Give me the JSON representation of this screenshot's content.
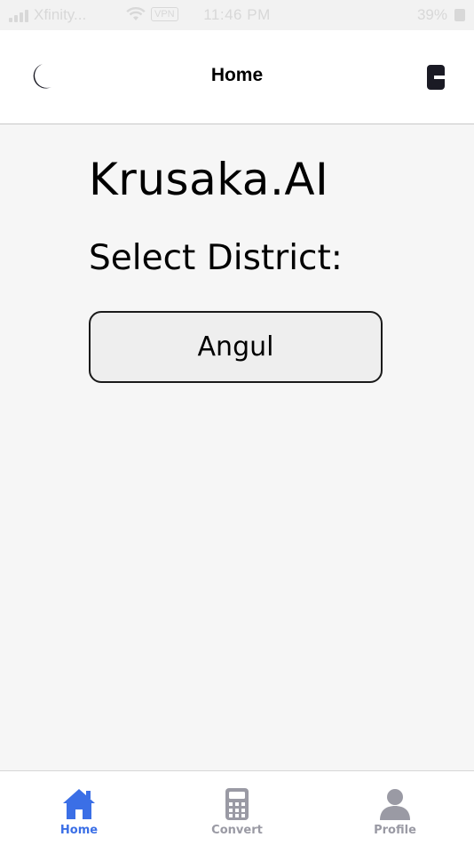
{
  "status_bar": {
    "carrier": "Xfinity...",
    "vpn": "VPN",
    "time": "11:46 PM",
    "battery": "39%"
  },
  "header": {
    "title": "Home",
    "left_icon": "moon-icon",
    "right_icon": "logout-icon"
  },
  "main": {
    "brand": "Krusaka.AI",
    "select_label": "Select District:",
    "selected_district": "Angul"
  },
  "tabs": [
    {
      "label": "Home",
      "icon": "home-icon",
      "active": true
    },
    {
      "label": "Convert",
      "icon": "calculator-icon",
      "active": false
    },
    {
      "label": "Profile",
      "icon": "user-icon",
      "active": false
    }
  ],
  "colors": {
    "accent": "#3b6fe6",
    "inactive_tab": "#9a9aa4",
    "background": "#f6f6f6"
  }
}
